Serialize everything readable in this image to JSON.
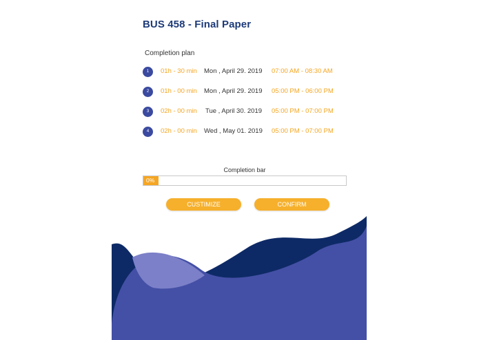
{
  "page": {
    "title": "BUS 458 - Final Paper"
  },
  "plan": {
    "label": "Completion plan",
    "items": [
      {
        "number": "1",
        "duration": "01h - 30 min",
        "date": "Mon , April 29. 2019",
        "time": "07:00 AM - 08:30 AM"
      },
      {
        "number": "2",
        "duration": "01h - 00 min",
        "date": "Mon , April 29. 2019",
        "time": "05:00 PM - 06:00 PM"
      },
      {
        "number": "3",
        "duration": "02h - 00 min",
        "date": "Tue , April 30. 2019",
        "time": "05:00 PM - 07:00 PM"
      },
      {
        "number": "4",
        "duration": "02h - 00 min",
        "date": "Wed , May 01. 2019",
        "time": "05:00 PM - 07:00 PM"
      }
    ]
  },
  "completion": {
    "label": "Completion bar",
    "percent_text": "0%",
    "progress": 0
  },
  "buttons": {
    "customize": "CUSTIMIZE",
    "confirm": "CONFIRM"
  },
  "colors": {
    "accent": "#f5a623",
    "title": "#1d3a78",
    "wave_dark": "#0e2a66",
    "wave_mid": "#4450a6",
    "wave_light": "#7c80c8"
  }
}
